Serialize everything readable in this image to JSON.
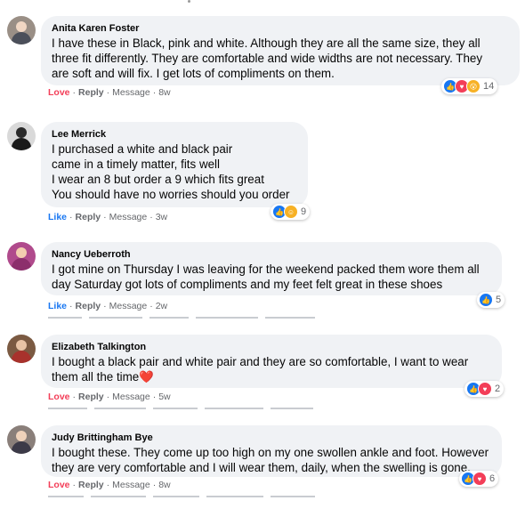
{
  "comments": [
    {
      "author": "Anita Karen Foster",
      "text": "I have these in Black, pink and white. Although they are all the same size, they all\nthree fit differently. They are comfortable and wide widths are not necessary. They\nare soft and will fix. I get lots of compliments on them.",
      "reaction_action": "Love",
      "reply": "Reply",
      "message": "Message",
      "time": "8w",
      "reaction_count": "14",
      "reactions": [
        "like-icon",
        "love-icon",
        "wow-icon"
      ]
    },
    {
      "author": "Lee Merrick",
      "text": "I purchased a white and black pair\ncame in a timely matter, fits well\nI wear an 8 but order a 9 which fits great\nYou should have no worries should you order",
      "reaction_action": "Like",
      "reply": "Reply",
      "message": "Message",
      "time": "3w",
      "reaction_count": "9",
      "reactions": [
        "like-icon",
        "care-icon"
      ]
    },
    {
      "author": "Nancy Ueberroth",
      "text": "I got mine on Thursday I was leaving for the weekend packed them wore them all\nday Saturday got lots of compliments and my feet felt great in these shoes",
      "reaction_action": "Like",
      "reply": "Reply",
      "message": "Message",
      "time": "2w",
      "reaction_count": "5",
      "reactions": [
        "like-icon"
      ]
    },
    {
      "author": "Elizabeth Talkington",
      "text": "I bought a black pair and white pair and they are so comfortable, I want to wear\nthem all the time❤️",
      "reaction_action": "Love",
      "reply": "Reply",
      "message": "Message",
      "time": "5w",
      "reaction_count": "2",
      "reactions": [
        "like-icon",
        "love-icon"
      ]
    },
    {
      "author": "Judy Brittingham Bye",
      "text": "I bought these. They come up too high on my one swollen ankle and foot. However\nthey are very comfortable and I will wear them, daily, when the swelling is gone.",
      "reaction_action": "Love",
      "reply": "Reply",
      "message": "Message",
      "time": "8w",
      "reaction_count": "6",
      "reactions": [
        "like-icon",
        "love-icon"
      ]
    }
  ],
  "colors": {
    "bubble": "#f0f2f5",
    "like": "#1877f2",
    "love": "#f33e58",
    "meta": "#65676b"
  }
}
